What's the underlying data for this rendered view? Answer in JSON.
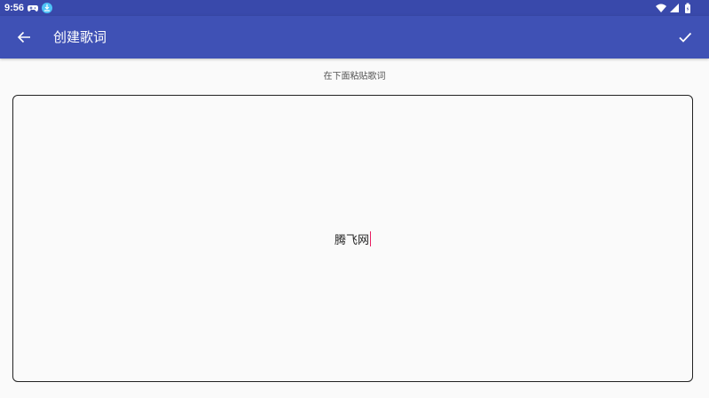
{
  "status_bar": {
    "time": "9:56",
    "icons": [
      "gamepad-icon",
      "download-icon",
      "wifi-icon",
      "signal-icon",
      "battery-icon"
    ]
  },
  "app_bar": {
    "title": "创建歌词",
    "back_icon": "arrow-back-icon",
    "confirm_icon": "check-icon",
    "background": "#3f51b5",
    "status_background": "#3949ab"
  },
  "editor": {
    "hint": "在下面粘贴歌词",
    "value": "腾飞网",
    "caret_color": "#e91e63"
  }
}
